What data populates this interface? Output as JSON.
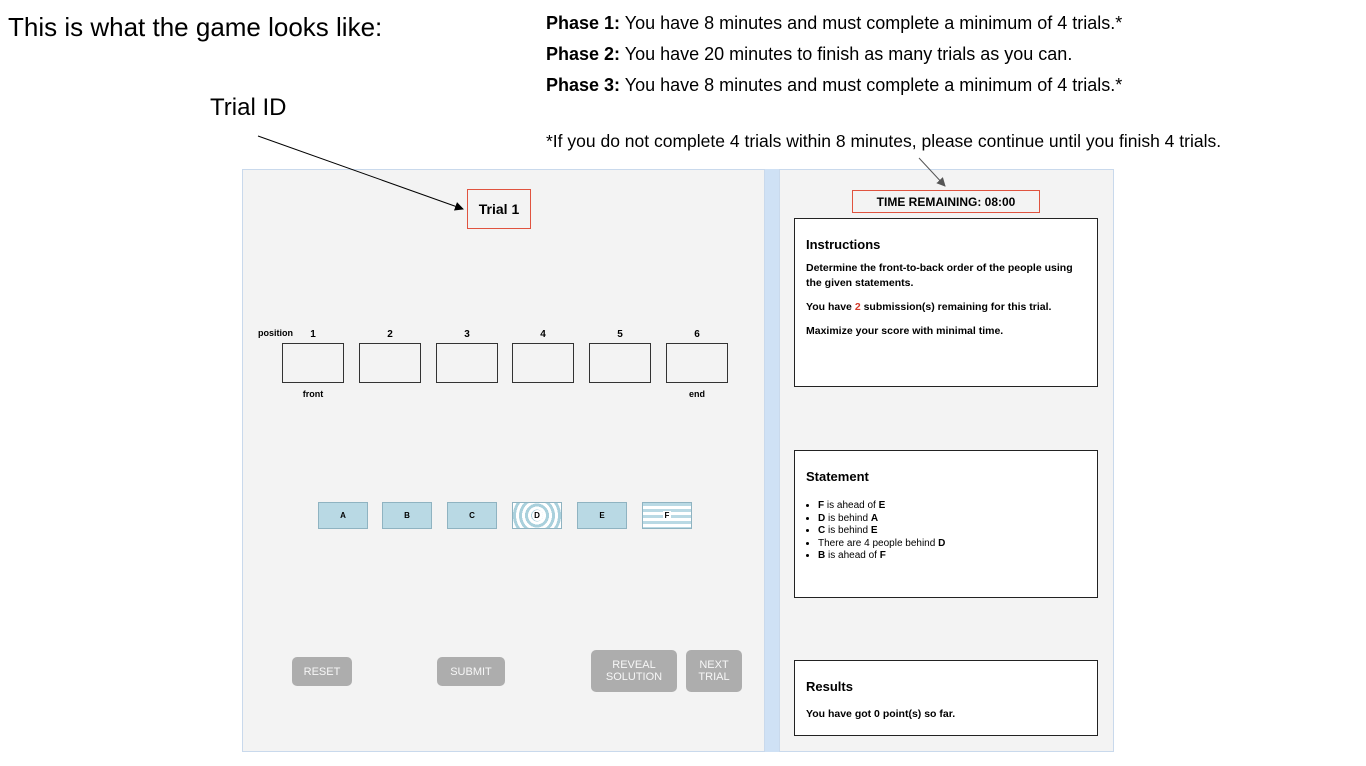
{
  "intro_text": "This is what the game looks like:",
  "trial_id_label": "Trial ID",
  "phases": [
    {
      "label": "Phase 1:",
      "text": "You have 8 minutes and must complete a minimum of 4 trials.*"
    },
    {
      "label": "Phase 2:",
      "text": "You have 20 minutes to finish as many trials as you can."
    },
    {
      "label": "Phase 3:",
      "text": "You have 8 minutes and must complete a minimum of 4 trials.*"
    }
  ],
  "footnote": "*If you do not complete 4 trials within 8 minutes, please continue until you finish 4 trials.",
  "game": {
    "trial_title": "Trial 1",
    "position_label": "position",
    "positions": [
      "1",
      "2",
      "3",
      "4",
      "5",
      "6"
    ],
    "front_label": "front",
    "end_label": "end",
    "tiles": [
      "A",
      "B",
      "C",
      "D",
      "E",
      "F"
    ],
    "buttons": {
      "reset": "RESET",
      "submit": "SUBMIT",
      "reveal_line1": "REVEAL",
      "reveal_line2": "SOLUTION",
      "next_line1": "NEXT",
      "next_line2": "TRIAL"
    },
    "timer": "TIME REMAINING: 08:00",
    "instructions": {
      "title": "Instructions",
      "line1": "Determine the front-to-back order of the people using the given statements.",
      "line2_prefix": "You have ",
      "submissions_remaining": "2",
      "line2_suffix": " submission(s) remaining for this trial.",
      "line3": "Maximize your score with minimal time."
    },
    "statement": {
      "title": "Statement",
      "items": [
        {
          "a": "F",
          "text": " is ahead of ",
          "b": "E"
        },
        {
          "a": "D",
          "text": " is behind ",
          "b": "A"
        },
        {
          "a": "C",
          "text": " is behind ",
          "b": "E"
        },
        {
          "a": "",
          "text": "There are 4 people behind ",
          "b": "D"
        },
        {
          "a": "B",
          "text": " is ahead of ",
          "b": "F"
        }
      ]
    },
    "results": {
      "title": "Results",
      "text": "You have got 0 point(s) so far."
    }
  },
  "colors": {
    "highlight_border": "#e0533f",
    "tile_fill": "#b9d9e4",
    "button_fill": "#adadad",
    "submission_count": "#d23a2a"
  }
}
